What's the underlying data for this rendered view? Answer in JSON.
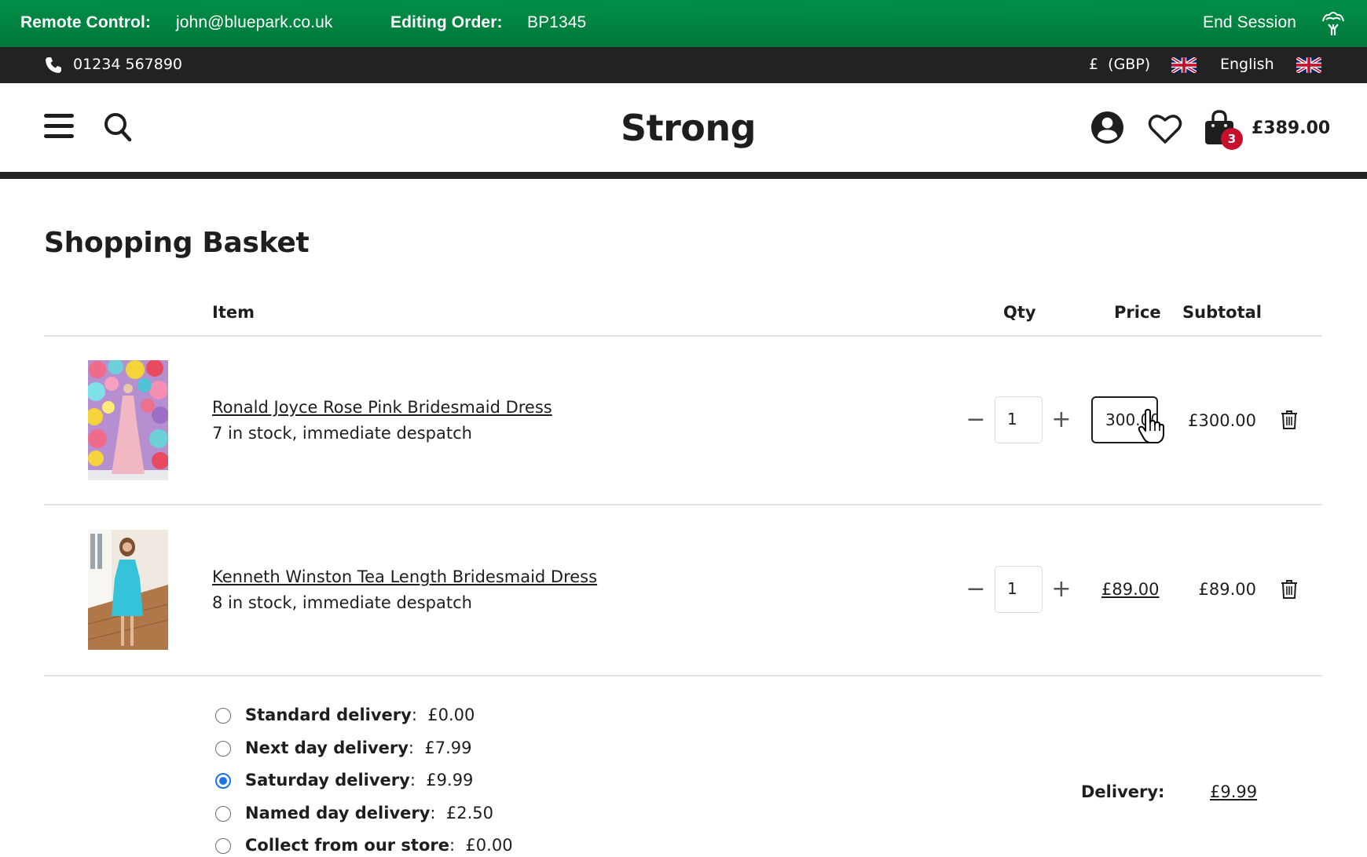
{
  "remote_bar": {
    "remote_label": "Remote Control:",
    "remote_user": "john@bluepark.co.uk",
    "order_label": "Editing Order:",
    "order_id": "BP1345",
    "end_session": "End Session",
    "logo_icon": "tree-icon",
    "background": "#008a44"
  },
  "top_bar": {
    "phone_icon": "phone-icon",
    "phone": "01234 567890",
    "currency": "£  (GBP)",
    "currency_flag": "uk-flag-icon",
    "language": "English",
    "language_flag": "uk-flag-icon"
  },
  "header": {
    "logo": "Strong",
    "menu_icon": "hamburger-icon",
    "search_icon": "search-icon",
    "account_icon": "account-icon",
    "wishlist_icon": "heart-icon",
    "basket_icon": "bag-icon",
    "basket_count": "3",
    "basket_total": "£389.00",
    "badge_color": "#c8102e"
  },
  "basket": {
    "title": "Shopping Basket",
    "columns": {
      "item": "Item",
      "qty": "Qty",
      "price": "Price",
      "subtotal": "Subtotal"
    },
    "items": [
      {
        "name": "Ronald Joyce Rose Pink Bridesmaid Dress",
        "stock": "7 in stock, immediate despatch",
        "qty": "1",
        "price": "300.00",
        "price_editing": true,
        "subtotal": "£300.00"
      },
      {
        "name": "Kenneth Winston Tea Length Bridesmaid Dress",
        "stock": "8 in stock, immediate despatch",
        "qty": "1",
        "price": "£89.00",
        "price_editing": false,
        "subtotal": "£89.00"
      }
    ],
    "qty_minus": "−",
    "qty_plus": "+"
  },
  "delivery": {
    "options": [
      {
        "name": "Standard delivery",
        "price": "£0.00",
        "selected": false
      },
      {
        "name": "Next day delivery",
        "price": "£7.99",
        "selected": false
      },
      {
        "name": "Saturday delivery",
        "price": "£9.99",
        "selected": true
      },
      {
        "name": "Named day delivery",
        "price": "£2.50",
        "selected": false
      },
      {
        "name": "Collect from our store",
        "price": "£0.00",
        "selected": false
      }
    ],
    "separator": ":",
    "summary_label": "Delivery:",
    "summary_value": "£9.99",
    "selected_color": "#1a73e8"
  }
}
